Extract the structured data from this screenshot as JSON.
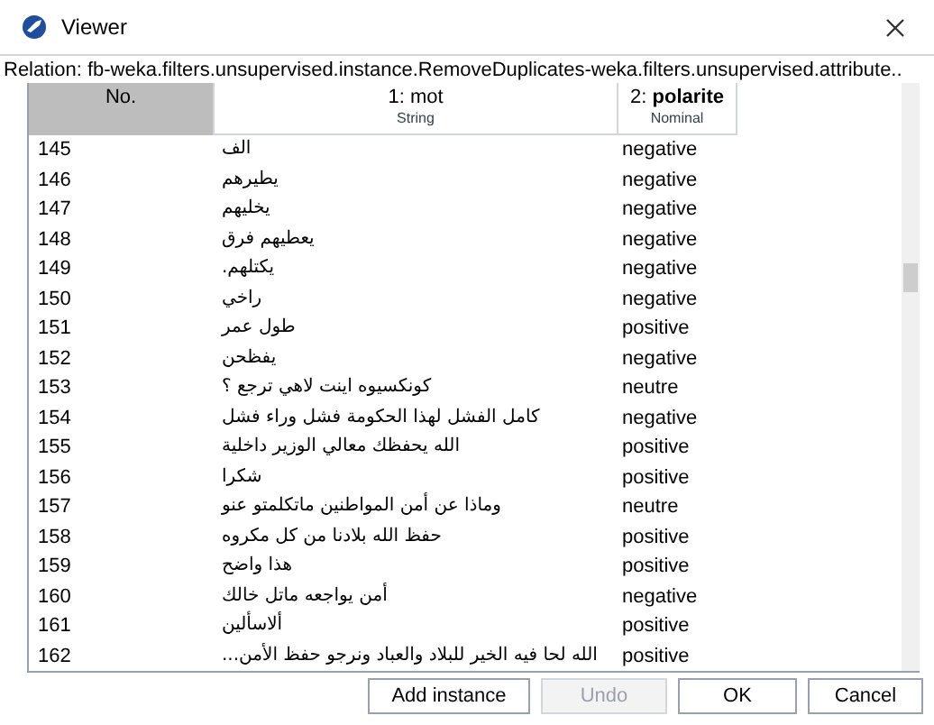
{
  "window": {
    "title": "Viewer"
  },
  "relation": "Relation: fb-weka.filters.unsupervised.instance.RemoveDuplicates-weka.filters.unsupervised.attribute..",
  "table": {
    "columns": [
      {
        "label": "No."
      },
      {
        "label": "1: mot",
        "type": "String",
        "bold": false
      },
      {
        "label": "2: polarite",
        "type": "Nominal",
        "bold": true
      }
    ],
    "rows": [
      [
        "145",
        "الف",
        "negative"
      ],
      [
        "146",
        "يطيرهم",
        "negative"
      ],
      [
        "147",
        "يخليهم",
        "negative"
      ],
      [
        "148",
        "يعطيهم فرق",
        "negative"
      ],
      [
        "149",
        "يكتلهم.",
        "negative"
      ],
      [
        "150",
        "راخي",
        "negative"
      ],
      [
        "151",
        "طول عمر",
        "positive"
      ],
      [
        "152",
        "يفظحن",
        "negative"
      ],
      [
        "153",
        "كونكسيوه اينت لاهي ترجع ؟",
        "neutre"
      ],
      [
        "154",
        "كامل الفشل لهذا الحكومة فشل وراء فشل",
        "negative"
      ],
      [
        "155",
        "الله يحفظك معالي الوزير داخلية",
        "positive"
      ],
      [
        "156",
        "شكرا",
        "positive"
      ],
      [
        "157",
        "وماذا عن أمن المواطنين ماتكلمتو عنو",
        "neutre"
      ],
      [
        "158",
        "حفظ الله بلادنا من كل مكروه",
        "positive"
      ],
      [
        "159",
        "هذا واضح",
        "positive"
      ],
      [
        "160",
        "أمن يواجعه ماتل خالك",
        "negative"
      ],
      [
        "161",
        "ألاسألين",
        "positive"
      ],
      [
        "162",
        "الله لحا فيه الخير للبلاد والعباد ونرجو حفظ الأمن...",
        "positive"
      ]
    ]
  },
  "buttons": [
    {
      "label": "Add instance",
      "disabled": false
    },
    {
      "label": "Undo",
      "disabled": true
    },
    {
      "label": "OK",
      "disabled": false
    },
    {
      "label": "Cancel",
      "disabled": false
    }
  ]
}
